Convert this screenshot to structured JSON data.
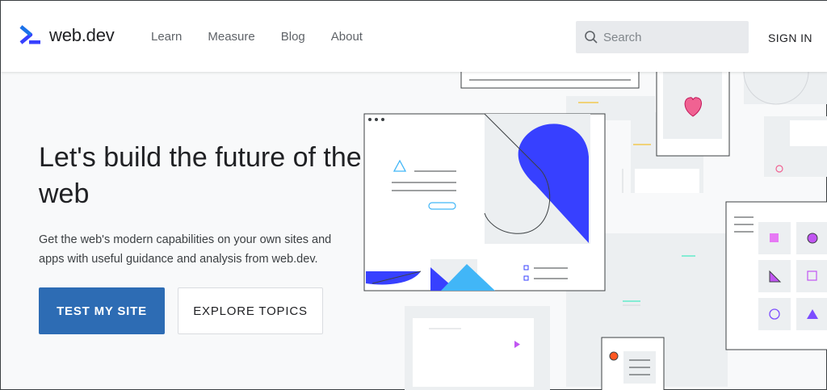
{
  "header": {
    "logo_text": "web.dev",
    "nav": [
      {
        "label": "Learn"
      },
      {
        "label": "Measure"
      },
      {
        "label": "Blog"
      },
      {
        "label": "About"
      }
    ],
    "search_placeholder": "Search",
    "signin_label": "SIGN IN"
  },
  "hero": {
    "title": "Let's build the future of the web",
    "description": "Get the web's modern capabilities on your own sites and apps with useful guidance and analysis from web.dev.",
    "primary_button": "TEST MY SITE",
    "secondary_button": "EXPLORE TOPICS"
  },
  "colors": {
    "brand_blue": "#3740ff",
    "button_blue": "#2d6cb4",
    "light_blue": "#41b6f7",
    "pink": "#f06292",
    "purple": "#c155f2"
  }
}
